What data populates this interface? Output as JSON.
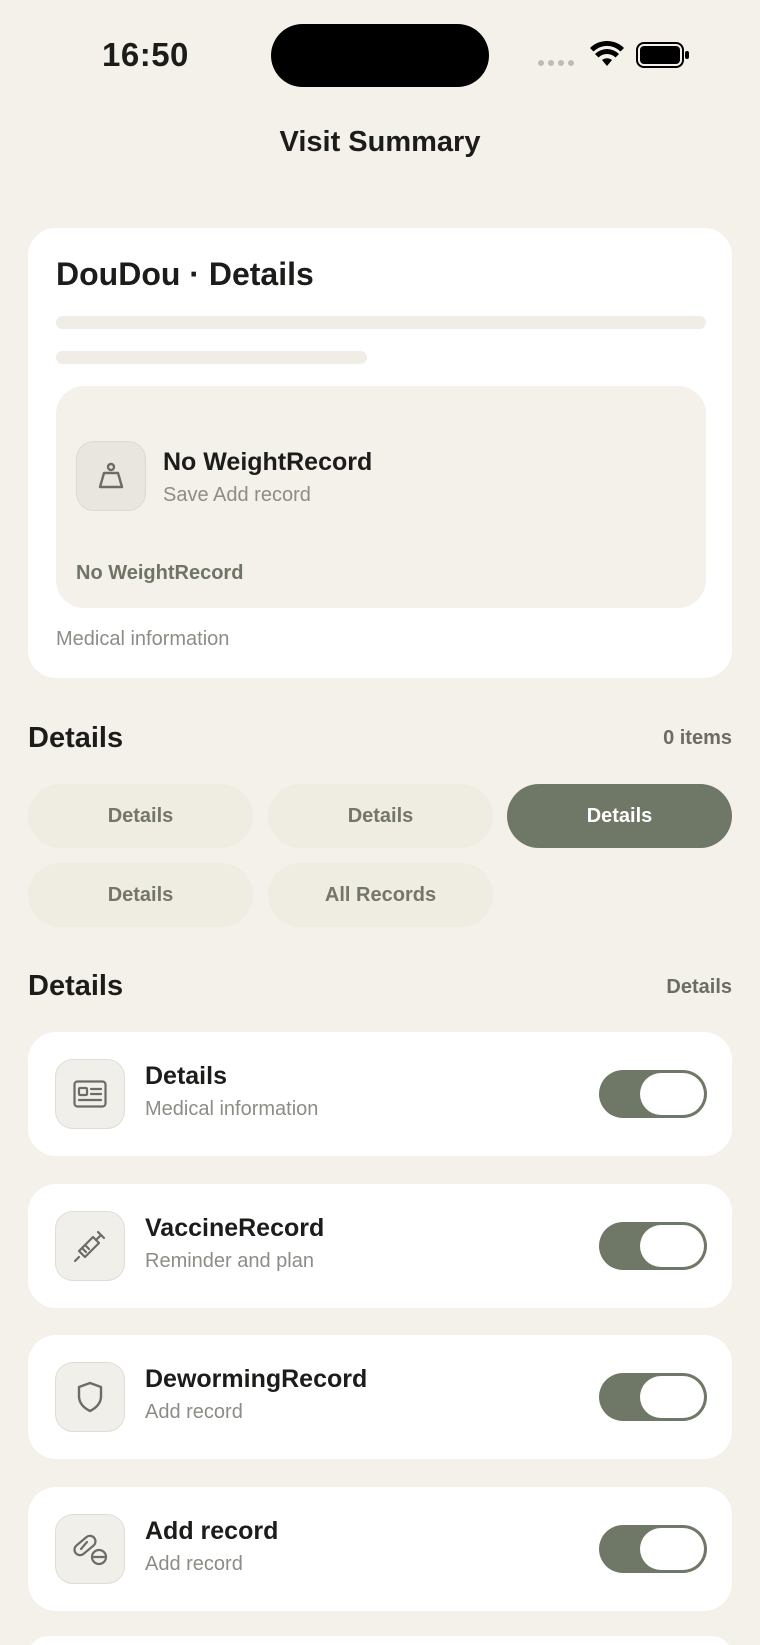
{
  "status_bar": {
    "time": "16:50"
  },
  "nav": {
    "title": "Visit Summary"
  },
  "summary": {
    "title": "DouDou · Details",
    "weight": {
      "title": "No WeightRecord",
      "subtitle": "Save Add record",
      "footer": "No WeightRecord",
      "icon": "scale-icon"
    },
    "footer": "Medical information"
  },
  "filter_section": {
    "title": "Details",
    "count": "0 items",
    "chips": [
      {
        "label": "Details",
        "active": false
      },
      {
        "label": "Details",
        "active": false
      },
      {
        "label": "Details",
        "active": true
      },
      {
        "label": "Details",
        "active": false
      },
      {
        "label": "All Records",
        "active": false
      }
    ]
  },
  "records_section": {
    "title": "Details",
    "action": "Details",
    "rows": [
      {
        "title": "Details",
        "subtitle": "Medical information",
        "icon": "id-card-icon",
        "enabled": true
      },
      {
        "title": "VaccineRecord",
        "subtitle": "Reminder and plan",
        "icon": "syringe-icon",
        "enabled": true
      },
      {
        "title": "DewormingRecord",
        "subtitle": "Add record",
        "icon": "shield-icon",
        "enabled": true
      },
      {
        "title": "Add record",
        "subtitle": "Add record",
        "icon": "pill-icon",
        "enabled": true
      }
    ]
  },
  "colors": {
    "background": "#f4f1ea",
    "accent": "#6f7766",
    "chip_bg": "#efece2",
    "muted_text": "#8d8c86"
  }
}
